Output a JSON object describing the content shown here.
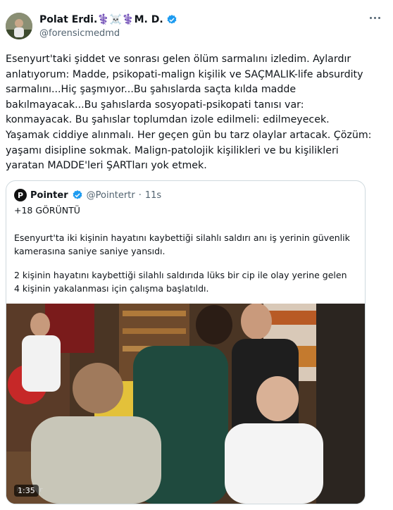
{
  "author": {
    "display_name": "Polat Erdi.⚕️☠️⚕️M. D.",
    "handle": "@forensicmedmd"
  },
  "tweet_text": [
    "Esenyurt'taki şiddet ve sonrası gelen ölüm sarmalını izledim. Aylardır anlatıyorum: Madde, psikopati-malign kişilik ve SAÇMALIK-life absurdity sarmalını...Hiç şaşmıyor...Bu şahıslarda saçta kılda madde bakılmayacak...Bu şahıslarda sosyopati-psikopati tanısı var: konmayacak. Bu şahıslar toplumdan izole edilmeli: edilmeyecek. Yaşamak ciddiye alınmalı. Her geçen gün bu tarz olaylar artacak. Çözüm: yaşamı disipline sokmak. Malign-patolojik kişilikleri ve bu kişilikleri yaratan MADDE'leri ŞARTları yok etmek."
  ],
  "quote": {
    "logo_letter": "P",
    "name": "Pointer",
    "handle": "@Pointertr",
    "separator": "·",
    "time": "11s",
    "tag": "+18 GÖRÜNTÜ",
    "paragraph1": "Esenyurt'ta iki kişinin hayatını kaybettiği silahlı saldırı anı iş yerinin güvenlik kamerasına saniye saniye yansıdı.",
    "paragraph2": "2 kişinin hayatını kaybettiği silahlı saldırıda lüks bir cip ile olay yerine gelen 4 kişinin yakalanması için çalışma başlatıldı.",
    "video": {
      "duration": "1:35",
      "watermark": "koridor"
    }
  },
  "colors": {
    "text": "#0f1419",
    "secondary": "#536471",
    "verified": "#1d9bf0",
    "border": "#cfd9de"
  }
}
